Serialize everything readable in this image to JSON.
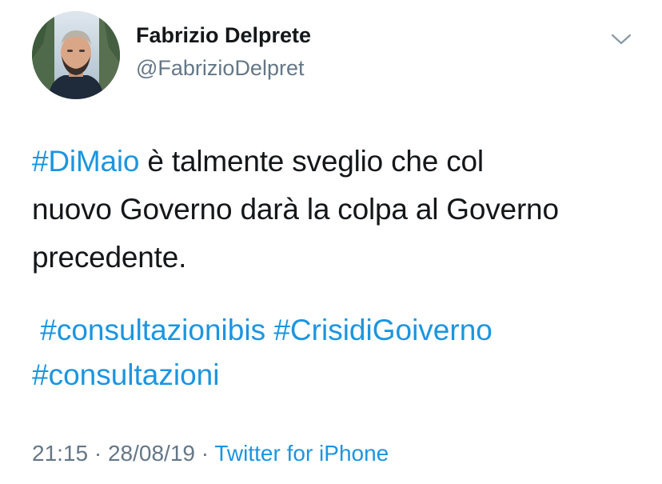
{
  "tweet": {
    "author_name": "Fabrizio Delprete",
    "author_handle": "@FabrizioDelpret",
    "body": {
      "line1_hashtag": "#DiMaio",
      "line1_rest": " è talmente sveglio che col",
      "line2": "nuovo Governo darà la colpa al Governo",
      "line3": "precedente."
    },
    "hashtags": {
      "tag1": "#consultazionibis",
      "tag2": "#CrisidiGoiverno",
      "tag3": "#consultazioni"
    },
    "meta": {
      "time": "21:15",
      "separator1": " · ",
      "date": "28/08/19",
      "separator2": " · ",
      "source": "Twitter for iPhone"
    },
    "icons": {
      "menu": "chevron-down-icon",
      "avatar": "avatar-photo"
    },
    "colors": {
      "link": "#1b95e0",
      "secondary": "#657786",
      "text": "#14171a"
    }
  }
}
